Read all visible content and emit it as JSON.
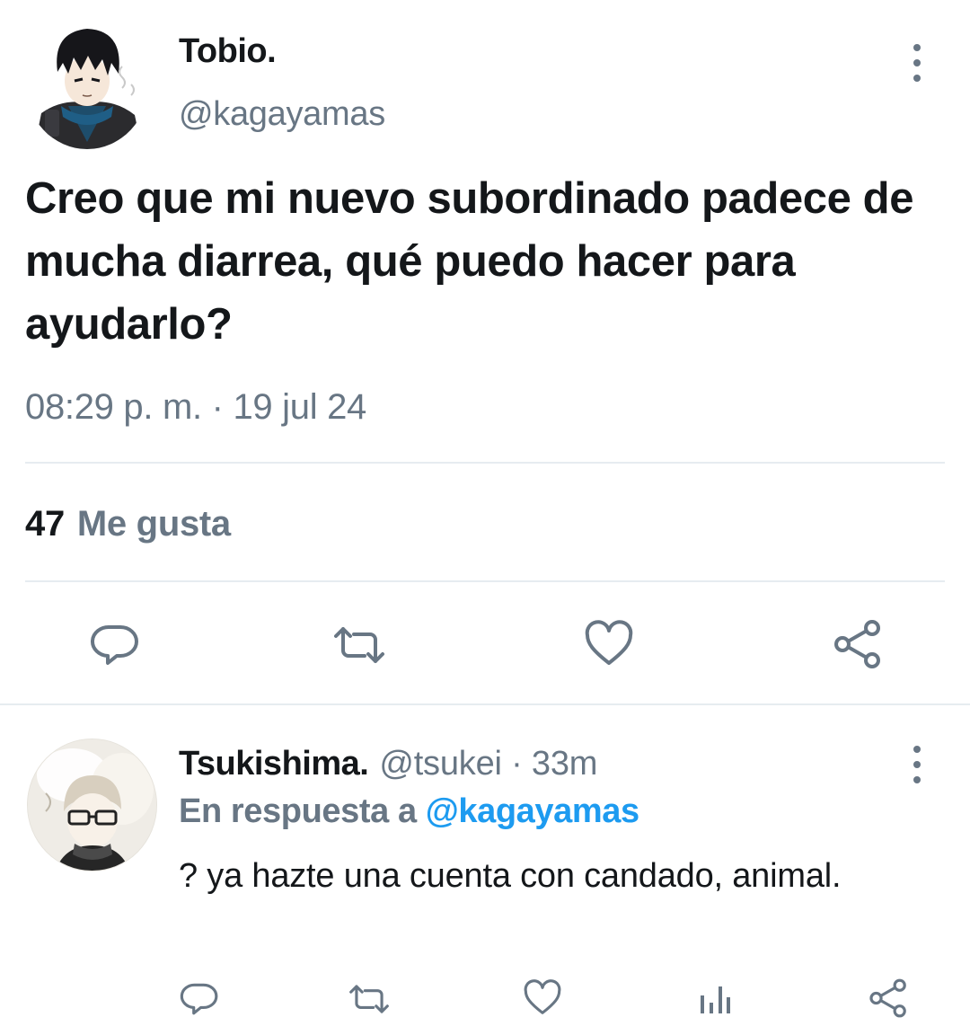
{
  "tweet": {
    "author_name": "Tobio.",
    "author_handle": "@kagayamas",
    "text": "Creo que mi nuevo subordinado padece de mucha diarrea, qué puedo hacer para ayudarlo?",
    "timestamp": "08:29 p. m. · 19 jul 24",
    "likes_count": "47",
    "likes_label": "Me gusta",
    "actions": [
      "reply-icon",
      "retweet-icon",
      "like-icon",
      "share-icon"
    ]
  },
  "reply": {
    "author_name": "Tsukishima.",
    "meta": "@tsukei · 33m",
    "in_reply_prefix": "En respuesta a",
    "in_reply_handle": "@kagayamas",
    "text": "? ya hazte una cuenta con candado, animal.",
    "actions": [
      "reply-icon",
      "retweet-icon",
      "like-icon",
      "analytics-icon",
      "share-icon"
    ]
  },
  "colors": {
    "text": "#14171a",
    "secondary": "#687684",
    "link": "#1d9bf0",
    "divider": "#e6ecf0"
  }
}
